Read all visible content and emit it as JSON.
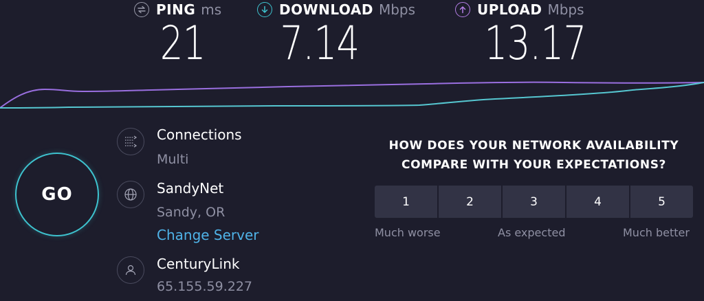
{
  "metrics": {
    "ping": {
      "label": "PING",
      "unit": "ms",
      "value": "21",
      "icon": "ping-icon",
      "color": "#9a9bab"
    },
    "download": {
      "label": "DOWNLOAD",
      "unit": "Mbps",
      "value": "7.14",
      "icon": "download-arrow-icon",
      "color": "#3ec3cf"
    },
    "upload": {
      "label": "UPLOAD",
      "unit": "Mbps",
      "value": "13.17",
      "icon": "upload-arrow-icon",
      "color": "#b47ee6"
    }
  },
  "graph": {
    "download_color": "#56c7d1",
    "upload_color": "#9a6fe0"
  },
  "go_button": {
    "label": "GO",
    "color": "#3ec3cf"
  },
  "info": {
    "connections": {
      "title": "Connections",
      "value": "Multi",
      "icon": "connections-icon"
    },
    "server": {
      "title": "SandyNet",
      "location": "Sandy, OR",
      "change_link": "Change Server",
      "icon": "globe-icon"
    },
    "provider": {
      "title": "CenturyLink",
      "ip": "65.155.59.227",
      "icon": "user-icon"
    }
  },
  "survey": {
    "question": "HOW DOES YOUR NETWORK AVAILABILITY COMPARE WITH YOUR EXPECTATIONS?",
    "options": [
      "1",
      "2",
      "3",
      "4",
      "5"
    ],
    "scale_labels": {
      "low": "Much worse",
      "mid": "As expected",
      "high": "Much better"
    }
  }
}
